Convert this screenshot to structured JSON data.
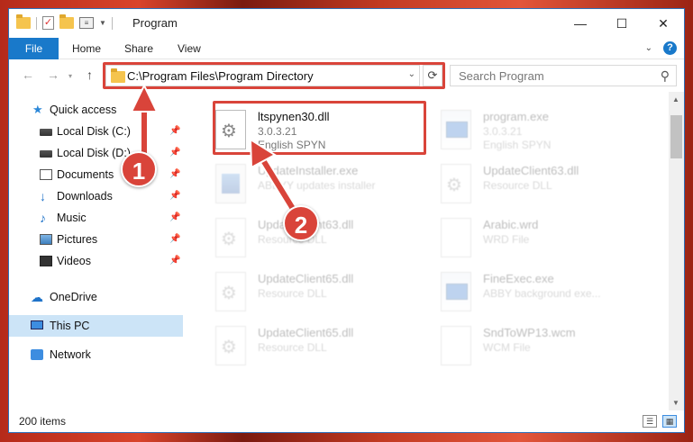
{
  "window": {
    "title": "Program",
    "buttons": {
      "minimize": "—",
      "maximize": "☐",
      "close": "✕"
    }
  },
  "ribbon": {
    "tabs": [
      "File",
      "Home",
      "Share",
      "View"
    ],
    "help": "?"
  },
  "nav": {
    "address": "C:\\Program Files\\Program Directory",
    "search_placeholder": "Search Program"
  },
  "sidebar": {
    "items": [
      {
        "label": "Quick access",
        "icon": "star-icon",
        "pinned": false
      },
      {
        "label": "Local Disk (C:)",
        "icon": "drive-icon",
        "pinned": true
      },
      {
        "label": "Local Disk (D:)",
        "icon": "drive-icon",
        "pinned": true
      },
      {
        "label": "Documents",
        "icon": "documents-icon",
        "pinned": true
      },
      {
        "label": "Downloads",
        "icon": "downloads-icon",
        "pinned": true
      },
      {
        "label": "Music",
        "icon": "music-icon",
        "pinned": true
      },
      {
        "label": "Pictures",
        "icon": "pictures-icon",
        "pinned": true
      },
      {
        "label": "Videos",
        "icon": "videos-icon",
        "pinned": true
      },
      {
        "label": "OneDrive",
        "icon": "onedrive-icon",
        "pinned": false
      },
      {
        "label": "This PC",
        "icon": "this-pc-icon",
        "pinned": false,
        "selected": true
      },
      {
        "label": "Network",
        "icon": "network-icon",
        "pinned": false
      }
    ]
  },
  "files": [
    {
      "name": "ltspynen30.dll",
      "line1": "3.0.3.21",
      "line2": "English SPYN",
      "icon": "dll-gear-icon",
      "highlighted": true
    },
    {
      "name": "program.exe",
      "line1": "3.0.3.21",
      "line2": "English SPYN",
      "icon": "exe-icon"
    },
    {
      "name": "UpdateInstaller.exe",
      "line1": "ABBYY updates installer",
      "line2": "",
      "icon": "installer-icon"
    },
    {
      "name": "UpdateClient63.dll",
      "line1": "Resource DLL",
      "line2": "",
      "icon": "dll-gear-icon"
    },
    {
      "name": "UpdateClient63.dll",
      "line1": "Resource DLL",
      "line2": "",
      "icon": "dll-gear-icon"
    },
    {
      "name": "Arabic.wrd",
      "line1": "WRD File",
      "line2": "",
      "icon": "blank-file-icon"
    },
    {
      "name": "UpdateClient65.dll",
      "line1": "Resource DLL",
      "line2": "",
      "icon": "dll-gear-icon"
    },
    {
      "name": "FineExec.exe",
      "line1": "ABBY background exe...",
      "line2": "",
      "icon": "exe-icon"
    },
    {
      "name": "UpdateClient65.dll",
      "line1": "Resource DLL",
      "line2": "",
      "icon": "dll-gear-icon"
    },
    {
      "name": "SndToWP13.wcm",
      "line1": "WCM File",
      "line2": "",
      "icon": "blank-file-icon"
    }
  ],
  "status": {
    "item_count": "200 items"
  },
  "annotations": {
    "step1": "1",
    "step2": "2",
    "color": "#d9443a"
  }
}
